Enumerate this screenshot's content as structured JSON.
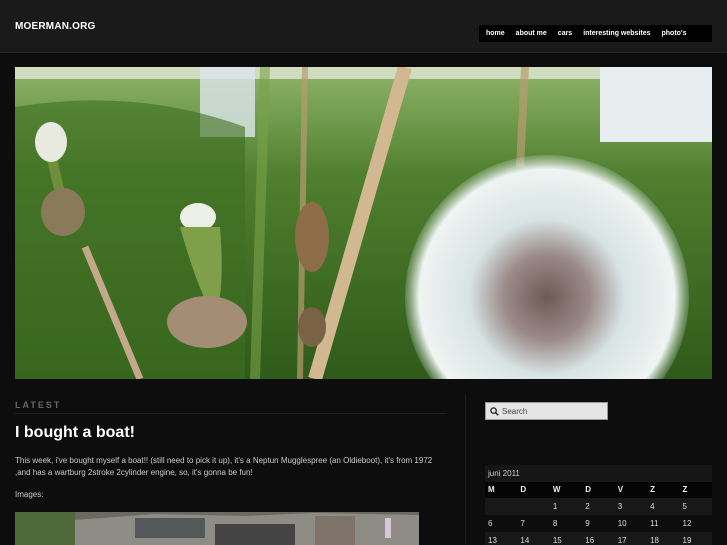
{
  "site": {
    "title": "MOERMAN.ORG"
  },
  "nav": {
    "items": [
      "home",
      "about me",
      "cars",
      "interesting websites",
      "photo's"
    ]
  },
  "section": {
    "label": "LATEST"
  },
  "post": {
    "title": "I bought a boat!",
    "body": "This week, i've bought myself a boat!! (still need to pick it up), it's a Neptun Mugglespree (an Oldieboot), it's from 1972 ,and has a wartburg 2stroke 2cylinder engine, so, it's gonna be fun!",
    "images_label": "Images:"
  },
  "search": {
    "placeholder": "Search"
  },
  "calendar": {
    "caption": "juni 2011",
    "weekdays": [
      "M",
      "D",
      "W",
      "D",
      "V",
      "Z",
      "Z"
    ],
    "rows": [
      [
        "",
        "",
        "1",
        "2",
        "3",
        "4",
        "5"
      ],
      [
        "6",
        "7",
        "8",
        "9",
        "10",
        "11",
        "12"
      ],
      [
        "13",
        "14",
        "15",
        "16",
        "17",
        "18",
        "19"
      ]
    ]
  }
}
